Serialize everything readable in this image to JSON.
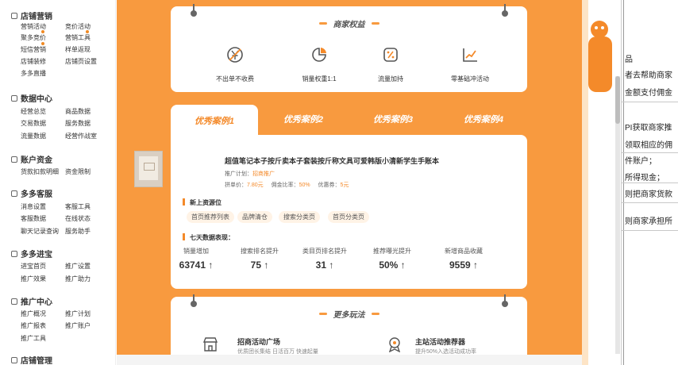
{
  "sidebar": {
    "sections": [
      {
        "title": "店铺营销",
        "items": [
          [
            "营销活动",
            "竞价活动"
          ],
          [
            "聚多竞价",
            "营销工具"
          ],
          [
            "短信营销",
            "样单返现"
          ],
          [
            "店铺装修",
            "店铺页设置"
          ],
          [
            "多多直播"
          ]
        ]
      },
      {
        "title": "数据中心",
        "items": [
          [
            "经营总览",
            "商品数据"
          ],
          [
            "交易数据",
            "服务数据"
          ],
          [
            "流量数据",
            "经营作战室"
          ]
        ]
      },
      {
        "title": "账户资金",
        "items": [
          [
            "货款扣款明细",
            "资金限制"
          ]
        ]
      },
      {
        "title": "多多客服",
        "items": [
          [
            "消息设置",
            "客服工具"
          ],
          [
            "客服数据",
            "在线状态"
          ],
          [
            "聊天记录查询",
            "服务助手"
          ]
        ]
      },
      {
        "title": "多多进宝",
        "items": [
          [
            "进宝首页",
            "推广设置"
          ],
          [
            "推广效果",
            "推广助力"
          ]
        ]
      },
      {
        "title": "推广中心",
        "items": [
          [
            "推广概况",
            "推广计划"
          ],
          [
            "推广报表",
            "推广账户"
          ],
          [
            "推广工具"
          ]
        ]
      },
      {
        "title": "店铺管理",
        "items": []
      }
    ]
  },
  "benefits": {
    "title": "商家权益",
    "items": [
      {
        "label": "不出单不收费",
        "icon": "no-charge-icon"
      },
      {
        "label": "销量权重1:1",
        "icon": "pie-chart-icon"
      },
      {
        "label": "流量加持",
        "icon": "percent-badge-icon"
      },
      {
        "label": "零基础冲活动",
        "icon": "trend-line-icon"
      }
    ]
  },
  "case_tabs": [
    "优秀案例1",
    "优秀案例2",
    "优秀案例3",
    "优秀案例4"
  ],
  "case": {
    "title": "超值笔记本子按斤卖本子套装按斤称文具可爱韩版小清新学生手账本",
    "plan_label": "推广计划：",
    "plan_value": "招商推广",
    "price_label": "拼单价：",
    "price_value": "7.80元",
    "commission_label": "佣金比率：",
    "commission_value": "50%",
    "coupon_label": "优惠券：",
    "coupon_value": "5元",
    "resource_title": "新上资源位",
    "resource_tags": [
      "首页推荐列表",
      "品牌清仓",
      "搜索分类页",
      "首页分类页"
    ],
    "data_title": "七天数据表现：",
    "stats": [
      {
        "label": "销量增加",
        "value": "63741 ↑"
      },
      {
        "label": "搜索排名提升",
        "value": "75 ↑"
      },
      {
        "label": "类目页排名提升",
        "value": "31 ↑"
      },
      {
        "label": "推荐曝光提升",
        "value": "50% ↑"
      },
      {
        "label": "新增商品收藏",
        "value": "9559 ↑"
      }
    ]
  },
  "more": {
    "title": "更多玩法",
    "items": [
      {
        "title": "招商活动广场",
        "desc": "优质团长集结 日活百万 快速起量",
        "icon": "store-icon"
      },
      {
        "title": "主站活动推荐器",
        "desc": "提升50%入选活动成功率",
        "icon": "award-icon"
      }
    ]
  },
  "doc_lines": [
    "品",
    "者去帮助商家",
    "金额支付佣金",
    "PI获取商家推",
    "领取相应的佣",
    "件账户；",
    "所得现金；",
    "则把商家货款",
    "则商家承担所"
  ],
  "colors": {
    "accent": "#f89a3f",
    "accent_dark": "#f48a2a"
  }
}
